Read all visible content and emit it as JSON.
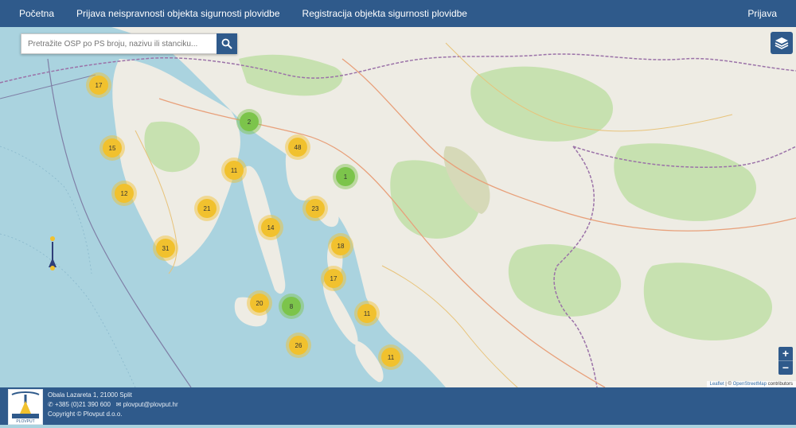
{
  "nav": {
    "links": [
      "Početna",
      "Prijava neispravnosti objekta sigurnosti plovidbe",
      "Registracija objekta sigurnosti plovidbe"
    ],
    "login": "Prijava"
  },
  "search": {
    "placeholder": "Pretražite OSP po PS broju, nazivu ili stanciku..."
  },
  "map": {
    "clusters": [
      {
        "count": "17",
        "color": "yellow"
      },
      {
        "count": "15",
        "color": "yellow"
      },
      {
        "count": "12",
        "color": "yellow"
      },
      {
        "count": "2",
        "color": "green"
      },
      {
        "count": "11",
        "color": "yellow"
      },
      {
        "count": "21",
        "color": "yellow"
      },
      {
        "count": "31",
        "color": "yellow"
      },
      {
        "count": "48",
        "color": "yellow"
      },
      {
        "count": "1",
        "color": "green"
      },
      {
        "count": "23",
        "color": "yellow"
      },
      {
        "count": "14",
        "color": "yellow"
      },
      {
        "count": "18",
        "color": "yellow"
      },
      {
        "count": "17",
        "color": "yellow"
      },
      {
        "count": "20",
        "color": "yellow"
      },
      {
        "count": "8",
        "color": "green"
      },
      {
        "count": "11",
        "color": "yellow"
      },
      {
        "count": "26",
        "color": "yellow"
      },
      {
        "count": "11",
        "color": "yellow"
      }
    ],
    "attribution": {
      "leaflet": "Leaflet",
      "sep": " | © ",
      "osm": "OpenStreetMap",
      "rest": " contributors"
    },
    "zoom_in": "+",
    "zoom_out": "−",
    "colors": {
      "water": "#aad3df",
      "land": "#f0ede6",
      "forest": "#c7e1b0",
      "cluster_yellow": "#f1c12e",
      "cluster_green": "#7cc44b",
      "brand": "#2f5a8b"
    }
  },
  "footer": {
    "address": "Obala Lazareta 1, 21000 Split",
    "phone": "+385 (0)21 390 600",
    "email": "plovput@plovput.hr",
    "copyright": "Copyright © Plovput d.o.o.",
    "logo_text": "PLOVPUT"
  }
}
